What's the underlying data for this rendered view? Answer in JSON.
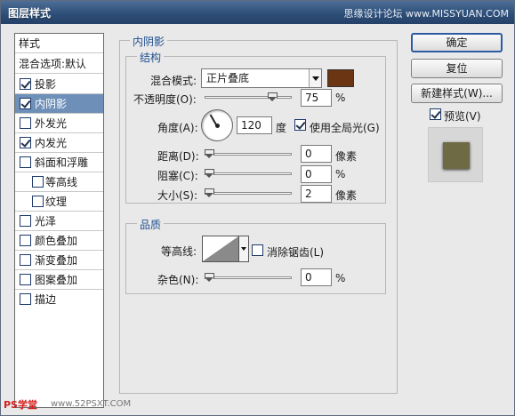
{
  "window": {
    "title": "图层样式",
    "watermark": "思缘设计论坛 www.MISSYUAN.COM"
  },
  "style_list": {
    "header": "样式",
    "items": [
      {
        "label": "混合选项:默认",
        "checked": null,
        "indent": 0
      },
      {
        "label": "投影",
        "checked": true,
        "indent": 1
      },
      {
        "label": "内阴影",
        "checked": true,
        "indent": 1,
        "selected": true
      },
      {
        "label": "外发光",
        "checked": false,
        "indent": 1
      },
      {
        "label": "内发光",
        "checked": true,
        "indent": 1
      },
      {
        "label": "斜面和浮雕",
        "checked": false,
        "indent": 1
      },
      {
        "label": "等高线",
        "checked": false,
        "indent": 2
      },
      {
        "label": "纹理",
        "checked": false,
        "indent": 2
      },
      {
        "label": "光泽",
        "checked": false,
        "indent": 1
      },
      {
        "label": "颜色叠加",
        "checked": false,
        "indent": 1
      },
      {
        "label": "渐变叠加",
        "checked": false,
        "indent": 1
      },
      {
        "label": "图案叠加",
        "checked": false,
        "indent": 1
      },
      {
        "label": "描边",
        "checked": false,
        "indent": 1
      }
    ]
  },
  "panel": {
    "section_title": "内阴影",
    "structure": {
      "title": "结构",
      "blend_mode_label": "混合模式:",
      "blend_mode_value": "正片叠底",
      "blend_color": "#6b3412",
      "opacity_label": "不透明度(O):",
      "opacity_value": "75",
      "opacity_unit": "%",
      "opacity_fraction": 0.75,
      "angle_label": "角度(A):",
      "angle_value": "120",
      "angle_unit": "度",
      "global_light_label": "使用全局光(G)",
      "global_light_checked": true,
      "distance_label": "距离(D):",
      "distance_value": "0",
      "distance_unit": "像素",
      "choke_label": "阻塞(C):",
      "choke_value": "0",
      "choke_unit": "%",
      "size_label": "大小(S):",
      "size_value": "2",
      "size_unit": "像素"
    },
    "quality": {
      "title": "品质",
      "contour_label": "等高线:",
      "anti_alias_label": "消除锯齿(L)",
      "anti_alias_checked": false,
      "noise_label": "杂色(N):",
      "noise_value": "0",
      "noise_unit": "%"
    }
  },
  "buttons": {
    "ok": "确定",
    "reset": "复位",
    "new_style": "新建样式(W)...",
    "preview_label": "预览(V)",
    "preview_checked": true
  },
  "footer": {
    "logo": "PS学堂",
    "url": "www.52PSXT.COM"
  }
}
